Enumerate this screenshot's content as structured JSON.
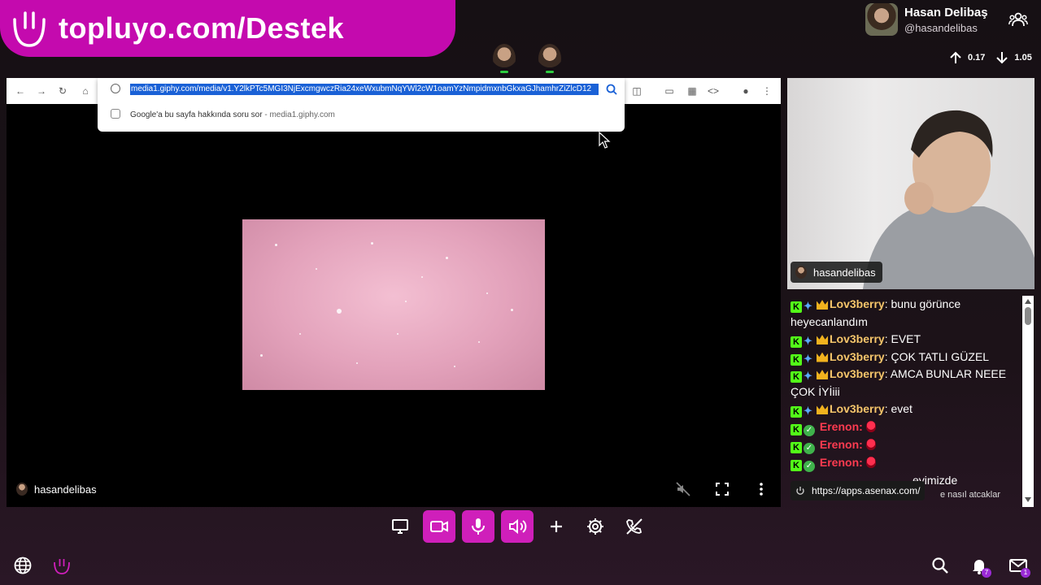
{
  "promo": {
    "text": "topluyo.com/Destek"
  },
  "user": {
    "name": "Hasan Delibaş",
    "handle": "@hasandelibas"
  },
  "network": {
    "upload": "0.17",
    "download": "1.05"
  },
  "browser": {
    "url": "media1.giphy.com/media/v1.Y2lkPTc5MGI3NjExcmgwczRia24xeWxubmNqYWl2cW1oamYzNmpidmxnbGkxaGJhamhrZiZlcD12",
    "suggestion": "Google'a bu sayfa hakkında soru sor",
    "suggestion_domain": " - media1.giphy.com"
  },
  "screen_share": {
    "owner": "hasandelibas"
  },
  "webcam": {
    "owner": "hasandelibas"
  },
  "chat": {
    "messages": [
      {
        "user": "Lov3berry",
        "text": "bunu görünce heyecanlandım"
      },
      {
        "user": "Lov3berry",
        "text": "EVET"
      },
      {
        "user": "Lov3berry",
        "text": "ÇOK TATLI GÜZEL"
      },
      {
        "user": "Lov3berry",
        "text": "AMCA BUNLAR NEEE ÇOK İYİiii"
      },
      {
        "user": "Lov3berry",
        "text": "evet"
      },
      {
        "user": "Erenon",
        "text": ""
      },
      {
        "user": "Erenon",
        "text": ""
      },
      {
        "user": "Erenon",
        "text": ""
      }
    ],
    "partial_text": "eyimizde",
    "partial_text_2": "e nasıl atcaklar"
  },
  "tooltip": {
    "url": "https://apps.asenax.com/"
  },
  "notifications": {
    "bell_count": "7",
    "mail_count": "1"
  },
  "colors": {
    "accent": "#cf1fba",
    "promo": "#c40aae",
    "kick_green": "#53fc18"
  }
}
